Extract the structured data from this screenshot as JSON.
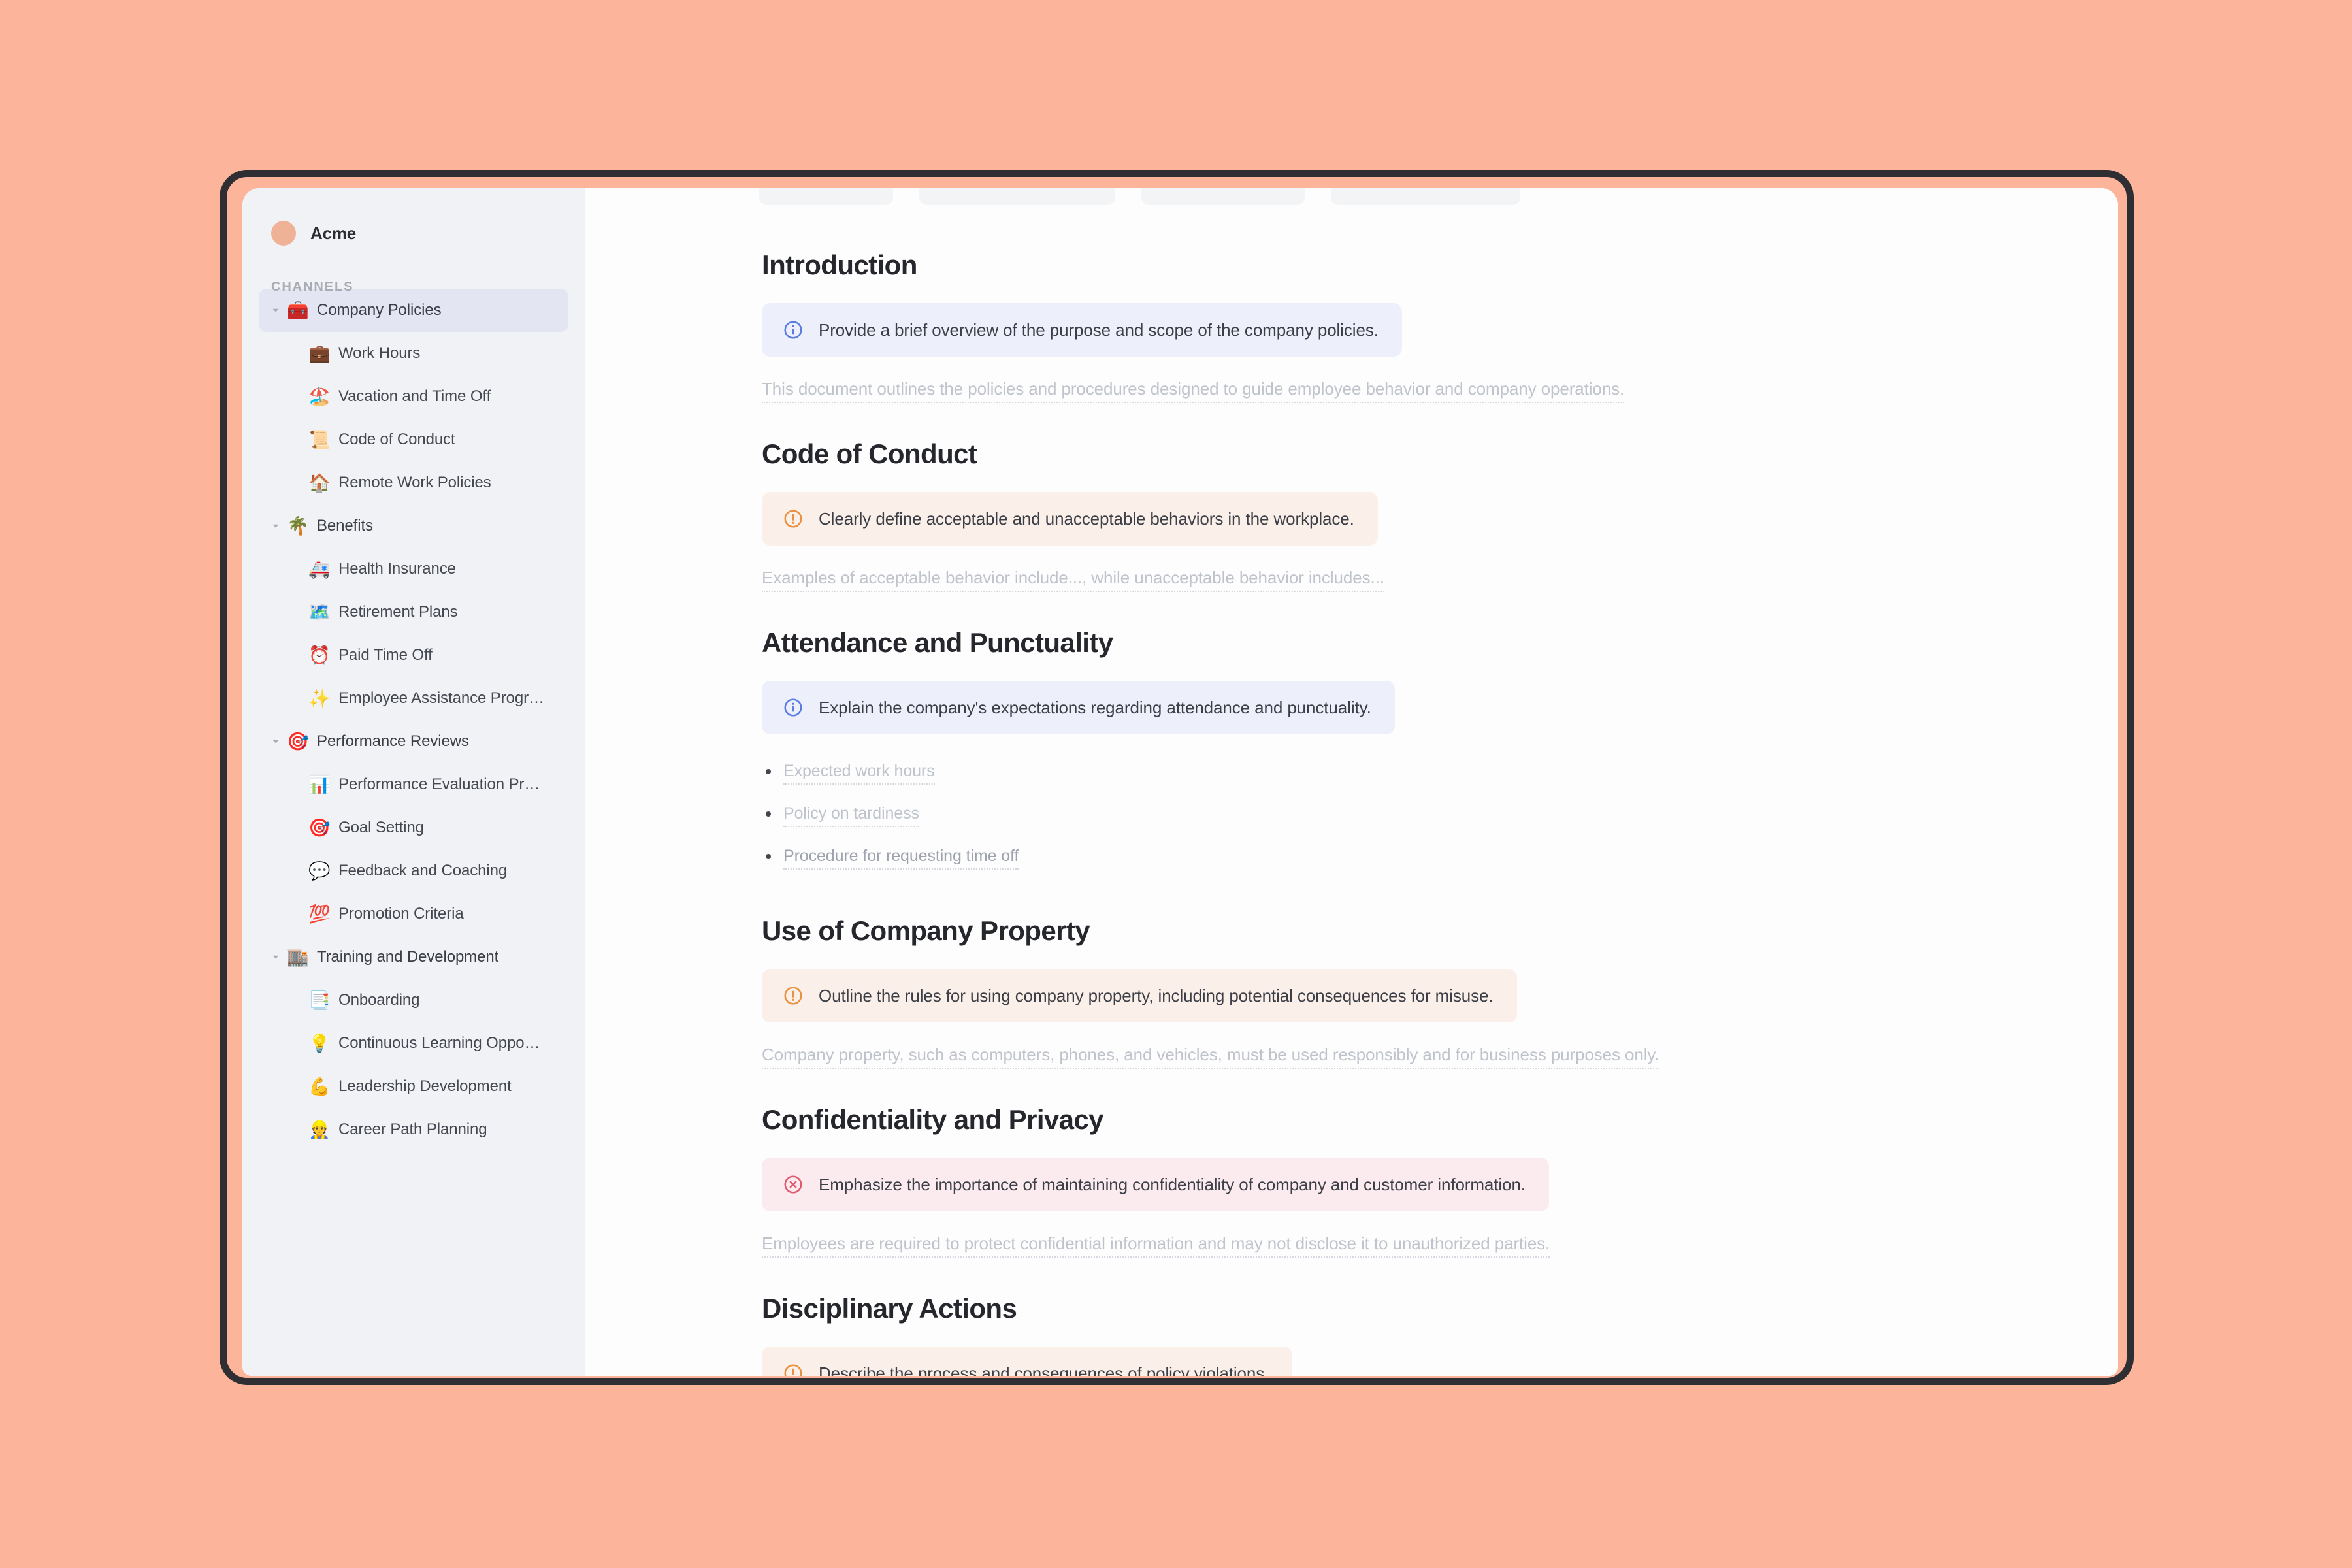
{
  "theme": {
    "page_background": "#FCB49A",
    "frame_border": "#2E2E33",
    "sidebar_background": "#F1F2F5",
    "selected_item_background": "#E3E5F3",
    "info_accent": "#5B7CE0",
    "warn_accent": "#E8923F",
    "error_accent": "#DD5C72"
  },
  "sidebar": {
    "workspace_name": "Acme",
    "section_label": "CHANNELS",
    "items": [
      {
        "label": "Company Policies",
        "emoji": "🧰",
        "level": "group",
        "selected": true,
        "expanded": true
      },
      {
        "label": "Work Hours",
        "emoji": "💼",
        "level": "child",
        "selected": false
      },
      {
        "label": "Vacation and Time Off",
        "emoji": "🏖️",
        "level": "child",
        "selected": false
      },
      {
        "label": "Code of Conduct",
        "emoji": "📜",
        "level": "child",
        "selected": false
      },
      {
        "label": "Remote Work Policies",
        "emoji": "🏠",
        "level": "child",
        "selected": false
      },
      {
        "label": "Benefits",
        "emoji": "🌴",
        "level": "group",
        "selected": false,
        "expanded": true
      },
      {
        "label": "Health Insurance",
        "emoji": "🚑",
        "level": "child",
        "selected": false
      },
      {
        "label": "Retirement Plans",
        "emoji": "🗺️",
        "level": "child",
        "selected": false
      },
      {
        "label": "Paid Time Off",
        "emoji": "⏰",
        "level": "child",
        "selected": false
      },
      {
        "label": "Employee Assistance Progr…",
        "emoji": "✨",
        "level": "child",
        "selected": false
      },
      {
        "label": "Performance Reviews",
        "emoji": "🎯",
        "level": "group",
        "selected": false,
        "expanded": true
      },
      {
        "label": "Performance Evaluation Pr…",
        "emoji": "📊",
        "level": "child",
        "selected": false
      },
      {
        "label": "Goal Setting",
        "emoji": "🎯",
        "level": "child",
        "selected": false
      },
      {
        "label": "Feedback and Coaching",
        "emoji": "💬",
        "level": "child",
        "selected": false
      },
      {
        "label": "Promotion Criteria",
        "emoji": "💯",
        "level": "child",
        "selected": false
      },
      {
        "label": "Training and Development",
        "emoji": "🏬",
        "level": "group",
        "selected": false,
        "expanded": true
      },
      {
        "label": "Onboarding",
        "emoji": "📑",
        "level": "child",
        "selected": false
      },
      {
        "label": "Continuous Learning Oppo…",
        "emoji": "💡",
        "level": "child",
        "selected": false
      },
      {
        "label": "Leadership Development",
        "emoji": "💪",
        "level": "child",
        "selected": false
      },
      {
        "label": "Career Path Planning",
        "emoji": "👷",
        "level": "child",
        "selected": false
      }
    ]
  },
  "document": {
    "sections": [
      {
        "heading": "Introduction",
        "callout": {
          "kind": "info",
          "text": "Provide a brief overview of the purpose and scope of the company policies."
        },
        "body": "This document outlines the policies and procedures designed to guide employee behavior and company operations."
      },
      {
        "heading": "Code of Conduct",
        "callout": {
          "kind": "warn",
          "text": "Clearly define acceptable and unacceptable behaviors in the workplace."
        },
        "body": "Examples of acceptable behavior include..., while unacceptable behavior includes..."
      },
      {
        "heading": "Attendance and Punctuality",
        "callout": {
          "kind": "info",
          "text": "Explain the company's expectations regarding attendance and punctuality."
        },
        "bullets": [
          "Expected work hours",
          "Policy on tardiness",
          "Procedure for requesting time off"
        ]
      },
      {
        "heading": "Use of Company Property",
        "callout": {
          "kind": "warn",
          "text": "Outline the rules for using company property, including potential consequences for misuse."
        },
        "body": "Company property, such as computers, phones, and vehicles, must be used responsibly and for business purposes only."
      },
      {
        "heading": "Confidentiality and Privacy",
        "callout": {
          "kind": "error",
          "text": "Emphasize the importance of maintaining confidentiality of company and customer information."
        },
        "body": "Employees are required to protect confidential information and may not disclose it to unauthorized parties."
      },
      {
        "heading": "Disciplinary Actions",
        "callout": {
          "kind": "warn",
          "text": "Describe the process and consequences of policy violations."
        }
      }
    ]
  }
}
